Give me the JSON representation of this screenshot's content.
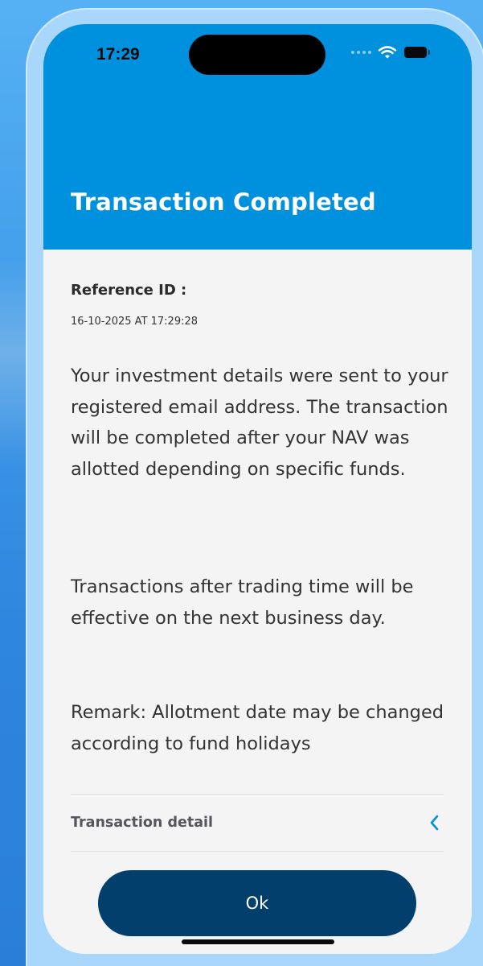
{
  "status_bar": {
    "time": "17:29"
  },
  "header": {
    "title": "Transaction Completed"
  },
  "reference": {
    "label": "Reference ID :",
    "datetime": "16-10-2025 AT 17:29:28"
  },
  "messages": [
    "Your investment details were sent to your registered email address. The transaction will be completed after your NAV was allotted depending on specific funds.",
    "Transactions after trading time will be effective on the next business day.",
    "Remark: Allotment date may be changed according to fund holidays"
  ],
  "transaction_detail": {
    "label": "Transaction detail",
    "icon": "chevron-left-icon"
  },
  "actions": {
    "ok_label": "Ok"
  },
  "colors": {
    "header_bg": "#0091de",
    "button_bg": "#033f6c",
    "chevron": "#0091de",
    "page_bg": "#f4f4f5"
  }
}
